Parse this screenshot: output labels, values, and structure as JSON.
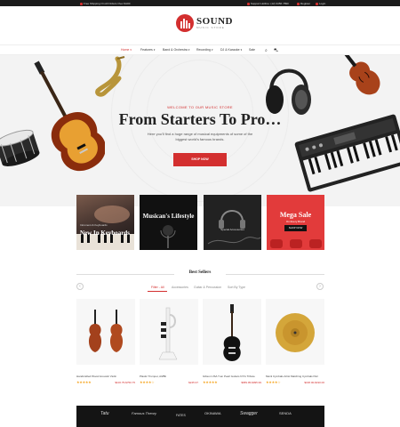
{
  "topbar": {
    "shipping": "Free Shipping On All Orders Over $100",
    "support": "Support Hotline: (12) 3456 7890",
    "register": "Register",
    "login": "Login"
  },
  "brand": {
    "name": "SOUND",
    "tagline": "MUSIC STORE",
    "accent": "#d32f2f"
  },
  "nav": {
    "items": [
      {
        "label": "Home",
        "active": true
      },
      {
        "label": "Features"
      },
      {
        "label": "Band & Orchestra"
      },
      {
        "label": "Recording"
      },
      {
        "label": "DJ & Karaoke"
      },
      {
        "label": "Sale"
      }
    ],
    "icons": [
      "search-icon",
      "cart-icon"
    ]
  },
  "hero": {
    "welcome": "WELCOME TO OUR MUSIC STORE",
    "title": "From Starters To Pro…",
    "description": "Here you'll find a huge range of musical equipments of some of the biggest world's famous brands.",
    "button": "SHOP NOW"
  },
  "categories": {
    "keyboards": {
      "sub": "Intrument & Keyboards",
      "title": "New In Keyboards"
    },
    "lifestyle": {
      "title": "Musican's Lifestyle"
    },
    "accessories": {
      "sub": "Special Accessories"
    },
    "sale": {
      "title": "Mega Sale",
      "sub": "On Every Brand",
      "button": "SHOP NOW"
    }
  },
  "best_sellers": {
    "title": "Best Sellers",
    "tabs": [
      "Filter - All",
      "Accessories",
      "Guitar & Percussion",
      "Sort By Type"
    ],
    "products": [
      {
        "name": "Handcrafted Wood Acoustic Violin",
        "price": "$100.75-$750.75",
        "stars": "★★★★★"
      },
      {
        "name": "Plastic Trumpet, Alt/Bb",
        "price": "$245.97",
        "stars": "★★★★☆"
      },
      {
        "name": "Gibson USA T-an Pearl Guitars NYG Tribute",
        "price": "$689.95-$995.99",
        "stars": "★★★★★"
      },
      {
        "name": "Meinl Cymbals Artist Matching Cymbals Pair",
        "price": "$168.00-$190.00",
        "stars": "★★★★☆"
      }
    ]
  },
  "brand_logos": [
    "Tatu",
    "Famous Theory",
    "FATES",
    "OKINAWA",
    "Swagger",
    "SENDA"
  ]
}
